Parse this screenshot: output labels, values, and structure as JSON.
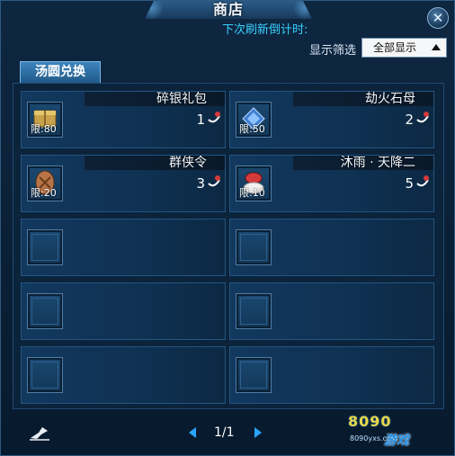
{
  "window": {
    "title": "商店",
    "close_glyph": "✕",
    "refresh_label": "下次刷新倒计时:",
    "filter": {
      "label": "显示筛选",
      "selected": "全部显示"
    },
    "tab": "汤圆兑换"
  },
  "items": [
    {
      "name": "碎银礼包",
      "limit": "限:80",
      "price": "1",
      "icon": "silver-gift-pack-icon"
    },
    {
      "name": "劫火石母",
      "limit": "限:50",
      "price": "2",
      "icon": "blue-crystal-stone-icon"
    },
    {
      "name": "群侠令",
      "limit": "限:20",
      "price": "3",
      "icon": "hero-token-icon"
    },
    {
      "name": "沐雨 · 天降二",
      "limit": "限:10",
      "price": "5",
      "icon": "red-bowl-icon"
    }
  ],
  "pager": {
    "text": "1/1"
  },
  "watermark": {
    "text": "8090",
    "sub": "8090yxs.com",
    "brand": "游戏"
  },
  "colors": {
    "accent": "#39d0ff",
    "cell_border": "#245582",
    "pager_arrow": "#2aa4ff"
  }
}
